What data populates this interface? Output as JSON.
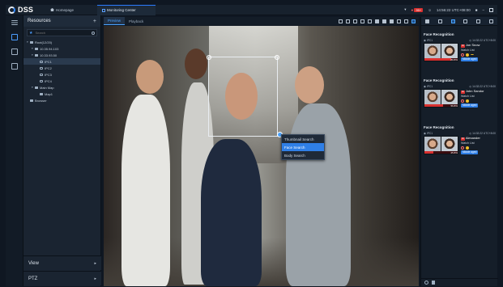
{
  "titlebar": {
    "app_name": "DSS",
    "home_tab": "Homepage",
    "active_tab": "Monitoring Center",
    "alarm_count": "99+",
    "clock": "14:56:22 UTC+08:00"
  },
  "resources": {
    "title": "Resources",
    "search_placeholder": "Search",
    "tree": [
      {
        "label": "Root(12/20)",
        "level": 0,
        "kind": "root"
      },
      {
        "label": "10.35.94.103",
        "level": 1,
        "kind": "device"
      },
      {
        "label": "10.33.93.50",
        "level": 1,
        "kind": "device"
      },
      {
        "label": "IPC1",
        "level": 2,
        "kind": "camera",
        "selected": true
      },
      {
        "label": "IPC2",
        "level": 2,
        "kind": "camera"
      },
      {
        "label": "IPC3",
        "level": 2,
        "kind": "camera"
      },
      {
        "label": "IPC4",
        "level": 2,
        "kind": "camera"
      },
      {
        "label": "Main Map",
        "level": 1,
        "kind": "map"
      },
      {
        "label": "Map1",
        "level": 2,
        "kind": "map"
      },
      {
        "label": "Browser",
        "level": 0,
        "kind": "browser"
      }
    ],
    "footer": [
      {
        "label": "View"
      },
      {
        "label": "PTZ"
      }
    ]
  },
  "video": {
    "tabs": [
      {
        "label": "Preview",
        "active": true
      },
      {
        "label": "Playback",
        "active": false
      }
    ],
    "context_menu": [
      {
        "label": "Thumbnail Search",
        "highlighted": false
      },
      {
        "label": "Face Search",
        "highlighted": true
      },
      {
        "label": "Body Search",
        "highlighted": false
      }
    ]
  },
  "face_recognition": [
    {
      "title": "Face Recognition",
      "channel": "IPC1",
      "time": "14:32:22 UTC+8:00",
      "name": "Jon Snow",
      "list": "Watch List",
      "similarity": "80.8%",
      "similarity_value": 80.8,
      "age": "Middle aged"
    },
    {
      "title": "Face Recognition",
      "channel": "IPC1",
      "time": "14:32:22 UTC+8:00",
      "name": "John Sandor",
      "list": "Watch List",
      "similarity": "56.8%",
      "similarity_value": 56.8,
      "age": "Middle aged"
    },
    {
      "title": "Face Recognition",
      "channel": "IPC1",
      "time": "14:32:22 UTC+8:00",
      "name": "Alexander",
      "list": "Watch List",
      "similarity": "25.8%",
      "similarity_value": 25.8,
      "age": "Middle aged"
    }
  ],
  "colors": {
    "accent": "#2f7fe6",
    "alert": "#d9302f",
    "background": "#0f1722"
  }
}
